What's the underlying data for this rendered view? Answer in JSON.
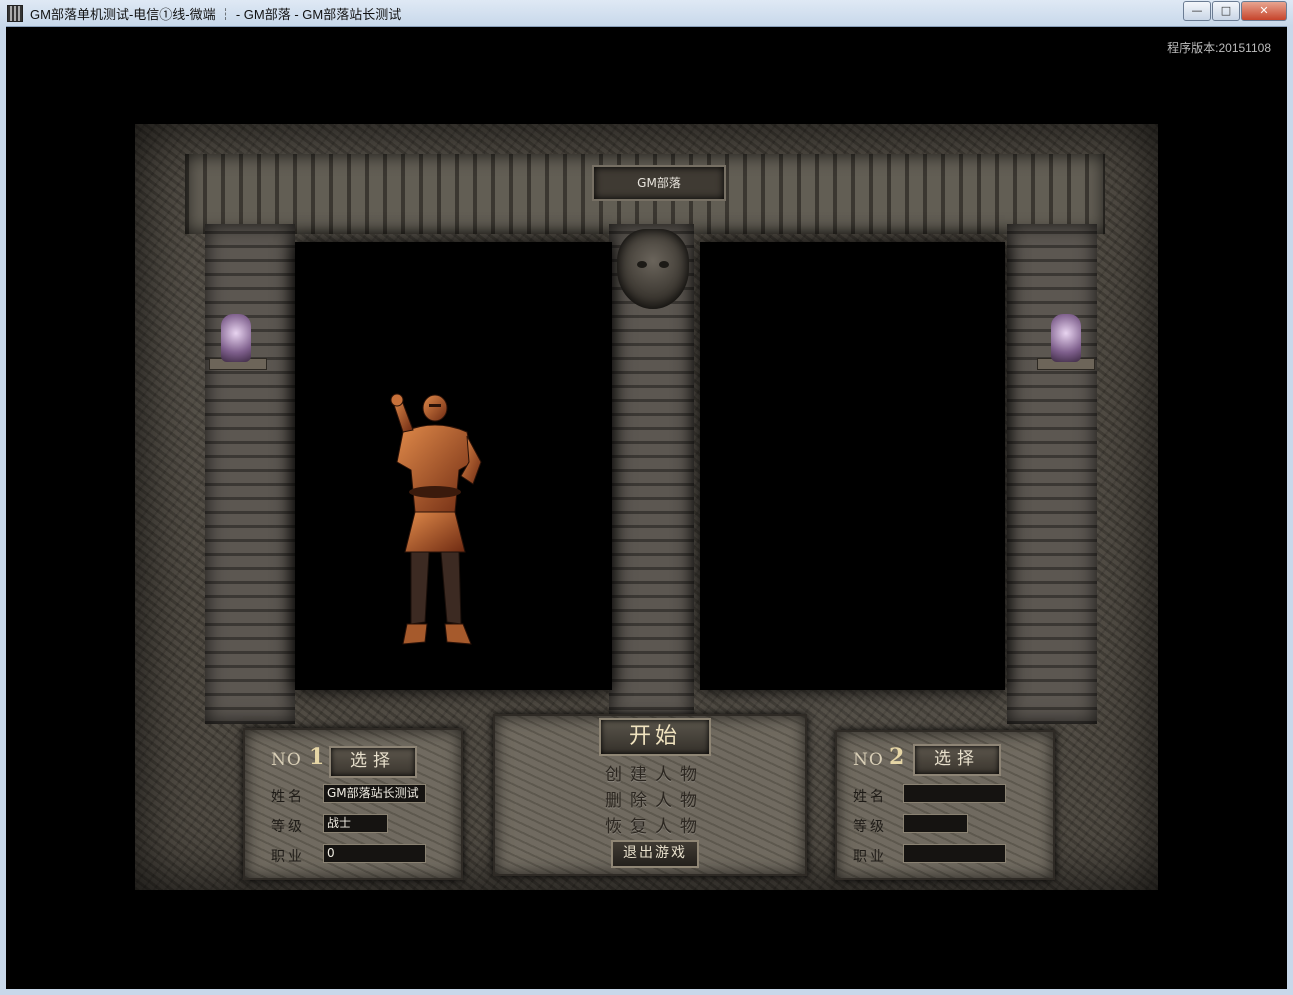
{
  "window": {
    "title": "GM部落单机测试-电信①线-微端 ┆ - GM部落 - GM部落站长测试",
    "minimize_glyph": "—",
    "maximize_glyph": "□",
    "close_glyph": "✕"
  },
  "version_label": "程序版本:20151108",
  "server_name": "GM部落",
  "slot1": {
    "no_label": "NO",
    "no_number": "1",
    "select_label": "选择",
    "name_label": "姓名",
    "name_value": "GM部落站长测试",
    "level_label": "等级",
    "level_value": "战士",
    "job_label": "职业",
    "job_value": "0"
  },
  "slot2": {
    "no_label": "NO",
    "no_number": "2",
    "select_label": "选择",
    "name_label": "姓名",
    "name_value": "",
    "level_label": "等级",
    "level_value": "",
    "job_label": "职业",
    "job_value": ""
  },
  "menu": {
    "start_label": "开始",
    "create_label": "创建人物",
    "delete_label": "删除人物",
    "restore_label": "恢复人物",
    "exit_label": "退出游戏"
  },
  "colors": {
    "stone": "#4b463e",
    "text_light": "#e8e0cc",
    "text_dark": "#2b2620",
    "armor": "#b0542a"
  }
}
